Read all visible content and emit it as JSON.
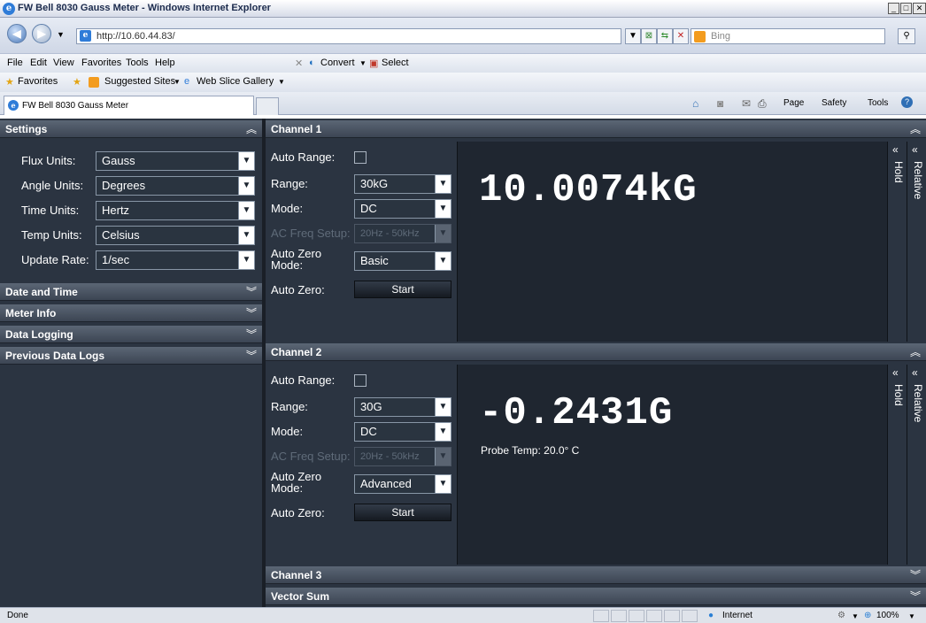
{
  "browser": {
    "window_title": "FW Bell 8030 Gauss Meter - Windows Internet Explorer",
    "url": "http://10.60.44.83/",
    "search_placeholder": "Bing",
    "menu": [
      "File",
      "Edit",
      "View",
      "Favorites",
      "Tools",
      "Help"
    ],
    "convert_label": "Convert",
    "select_label": "Select",
    "favorites_label": "Favorites",
    "fav_links": [
      "Suggested Sites",
      "Web Slice Gallery"
    ],
    "tab_label": "FW Bell 8030 Gauss Meter",
    "cmd": [
      "Page",
      "Safety",
      "Tools"
    ],
    "status_left": "Done",
    "zone": "Internet",
    "zoom": "100%"
  },
  "sidebar": {
    "settings_title": "Settings",
    "fields": [
      {
        "label": "Flux Units:",
        "value": "Gauss"
      },
      {
        "label": "Angle Units:",
        "value": "Degrees"
      },
      {
        "label": "Time Units:",
        "value": "Hertz"
      },
      {
        "label": "Temp Units:",
        "value": "Celsius"
      },
      {
        "label": "Update Rate:",
        "value": "1/sec"
      }
    ],
    "sections": [
      "Date and Time",
      "Meter Info",
      "Data Logging",
      "Previous Data Logs"
    ]
  },
  "channels": [
    {
      "title": "Channel 1",
      "auto_range_label": "Auto Range:",
      "range_label": "Range:",
      "range_value": "30kG",
      "mode_label": "Mode:",
      "mode_value": "DC",
      "acfreq_label": "AC Freq Setup:",
      "acfreq_value": "20Hz - 50kHz",
      "azmode_label": "Auto Zero Mode:",
      "azmode_value": "Basic",
      "az_label": "Auto Zero:",
      "az_button": "Start",
      "reading": "10.0074kG",
      "probe_temp": "",
      "hold": "Hold",
      "relative": "Relative"
    },
    {
      "title": "Channel 2",
      "auto_range_label": "Auto Range:",
      "range_label": "Range:",
      "range_value": "30G",
      "mode_label": "Mode:",
      "mode_value": "DC",
      "acfreq_label": "AC Freq Setup:",
      "acfreq_value": "20Hz - 50kHz",
      "azmode_label": "Auto Zero Mode:",
      "azmode_value": "Advanced",
      "az_label": "Auto Zero:",
      "az_button": "Start",
      "reading": "-0.2431G",
      "probe_temp": "Probe Temp: 20.0° C",
      "hold": "Hold",
      "relative": "Relative"
    }
  ],
  "collapsed": [
    "Channel 3",
    "Vector Sum"
  ]
}
